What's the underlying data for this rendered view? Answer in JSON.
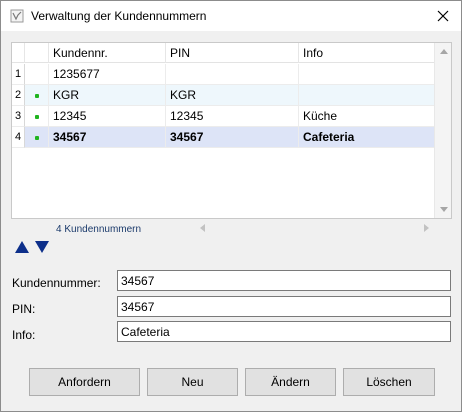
{
  "window": {
    "title": "Verwaltung der Kundennummern"
  },
  "grid": {
    "columns": [
      "Kundennr.",
      "PIN",
      "Info"
    ],
    "rows": [
      {
        "num": "1",
        "kundennr": "1235677",
        "pin": "",
        "info": "",
        "active": false
      },
      {
        "num": "2",
        "kundennr": "KGR",
        "pin": "KGR",
        "info": "",
        "active": true
      },
      {
        "num": "3",
        "kundennr": "12345",
        "pin": "12345",
        "info": "Küche",
        "active": true
      },
      {
        "num": "4",
        "kundennr": "34567",
        "pin": "34567",
        "info": "Cafeteria",
        "active": true
      }
    ],
    "selected_row": 4,
    "count_label": "4 Kundennummern"
  },
  "form": {
    "kundennummer_label": "Kundennummer:",
    "kundennummer_value": "34567",
    "pin_label": "PIN:",
    "pin_value": "34567",
    "info_label": "Info:",
    "info_value": "Cafeteria"
  },
  "buttons": {
    "anfordern": "Anfordern",
    "neu": "Neu",
    "aendern": "Ändern",
    "loeschen": "Löschen"
  },
  "colors": {
    "accent": "#0d2f8a",
    "selection": "#dde4f7",
    "alt_row": "#eef7fc",
    "active_dot": "#1fb41f"
  },
  "icons": {
    "app": "app-icon",
    "close": "close-icon",
    "move_up": "arrow-up-icon",
    "move_down": "arrow-down-icon"
  }
}
